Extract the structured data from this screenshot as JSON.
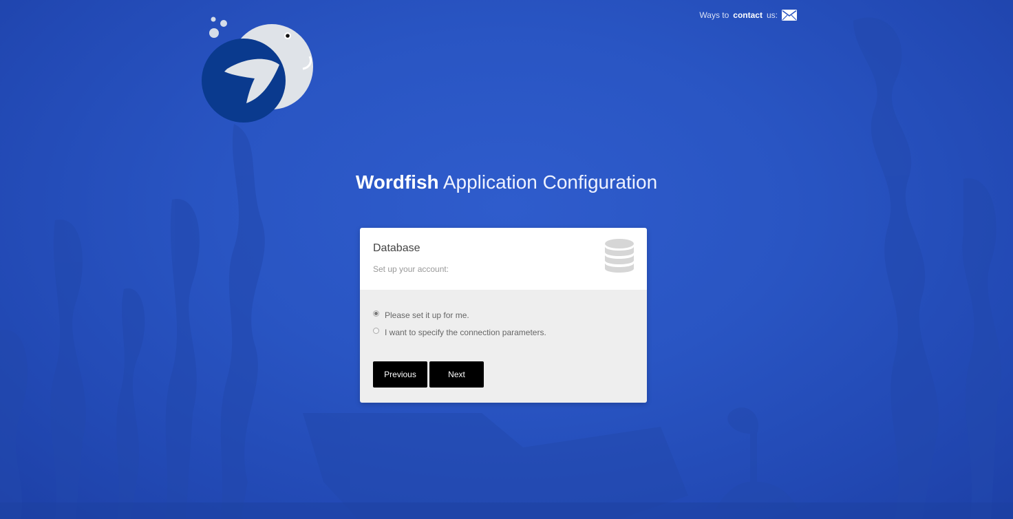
{
  "header": {
    "contact_prefix": "Ways to",
    "contact_link": "contact",
    "contact_suffix": "us:"
  },
  "title": {
    "brand": "Wordfish",
    "rest": "Application Configuration"
  },
  "card": {
    "heading": "Database",
    "subheading": "Set up your account:",
    "options": [
      {
        "label": "Please set it up for me.",
        "selected": true
      },
      {
        "label": "I want to specify the connection parameters.",
        "selected": false
      }
    ],
    "previous_label": "Previous",
    "next_label": "Next"
  },
  "icons": [
    "wordfish-logo",
    "mail-icon",
    "database-icon"
  ],
  "colors": {
    "background": "#2955c3",
    "button": "#000000",
    "card_body": "#eeeeee"
  }
}
